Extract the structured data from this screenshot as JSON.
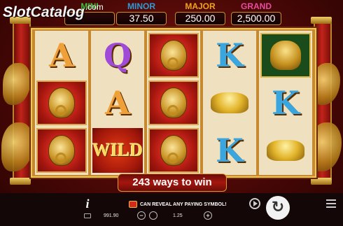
{
  "logo": {
    "slot": "Slot",
    "catalog": "Catalog",
    "com": ".com"
  },
  "jackpots": [
    {
      "label": "MINI",
      "value": "",
      "color": "#3cc23c"
    },
    {
      "label": "MINOR",
      "value": "37.50",
      "color": "#2f9bd6"
    },
    {
      "label": "MAJOR",
      "value": "250.00",
      "color": "#f0a21a"
    },
    {
      "label": "GRAND",
      "value": "2,500.00",
      "color": "#e84aa0"
    }
  ],
  "reels": [
    [
      {
        "type": "letter",
        "text": "A",
        "color": "#f0a038"
      },
      {
        "type": "knocker"
      },
      {
        "type": "knocker"
      }
    ],
    [
      {
        "type": "letter",
        "text": "Q",
        "color": "#a04ad8"
      },
      {
        "type": "letter",
        "text": "A",
        "color": "#f0a038"
      },
      {
        "type": "wild",
        "text": "WILD"
      }
    ],
    [
      {
        "type": "knocker"
      },
      {
        "type": "knocker"
      },
      {
        "type": "knocker"
      }
    ],
    [
      {
        "type": "letter",
        "text": "K",
        "color": "#3aa6e0"
      },
      {
        "type": "ingot"
      },
      {
        "type": "letter",
        "text": "K",
        "color": "#3aa6e0"
      }
    ],
    [
      {
        "type": "buddha"
      },
      {
        "type": "letter",
        "text": "K",
        "color": "#3aa6e0"
      },
      {
        "type": "ingot"
      }
    ]
  ],
  "ways_text": "243 ways to win",
  "info_label": "i",
  "message": "CAN REVEAL ANY PAYING SYMBOL!",
  "balance": "991.90",
  "bet": "1.25",
  "minus_label": "−",
  "plus_label": "+",
  "spin_icon": "↻",
  "icons": {
    "info": "info-icon",
    "wallet": "wallet-icon",
    "coins": "coins-icon",
    "autoplay": "autoplay-icon",
    "spin": "spin-icon",
    "menu": "menu-icon"
  }
}
